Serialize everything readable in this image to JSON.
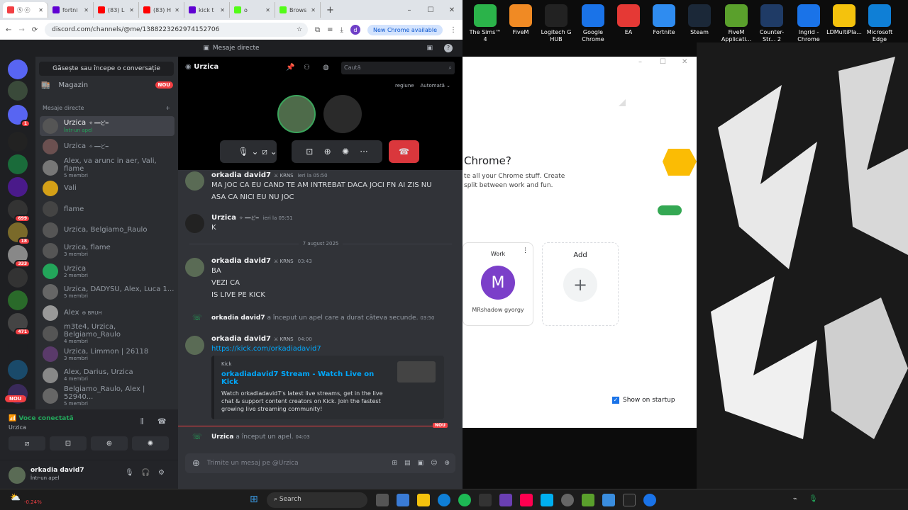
{
  "browser": {
    "tabs": [
      {
        "label": "Ⓢ ⓞ",
        "color": "#f23f43"
      },
      {
        "label": "fortni",
        "color": "#6001d2"
      },
      {
        "label": "(83) L",
        "color": "#ff0000"
      },
      {
        "label": "(83) H",
        "color": "#ff0000"
      },
      {
        "label": "kick t",
        "color": "#6001d2"
      },
      {
        "label": "o",
        "color": "#53fc18"
      },
      {
        "label": "Brows",
        "color": "#53fc18"
      }
    ],
    "url": "discord.com/channels/@me/1388223262974152706",
    "new_chrome": "New Chrome available",
    "profile_letter": "d"
  },
  "discord": {
    "title": "Mesaje directe",
    "find_conversation": "Găsește sau începe o conversație",
    "shop": "Magazin",
    "shop_badge": "NOU",
    "dm_header": "Mesaje directe",
    "dms": [
      {
        "name": "Urzica",
        "tag": "✧ ━━ど━",
        "sub": "Într-un apel",
        "color": "#555",
        "selected": true
      },
      {
        "name": "Urzica",
        "tag": "✧ ━━ど━",
        "sub": "",
        "color": "#6b5050"
      },
      {
        "name": "Alex, va arunc in aer, Vali, flame",
        "sub": "5 membri",
        "color": "#777"
      },
      {
        "name": "Vali",
        "sub": "",
        "color": "#d4a017"
      },
      {
        "name": "flame",
        "sub": "",
        "color": "#444"
      },
      {
        "name": "Urzica, Belgiamo_Raulo",
        "sub": "",
        "color": "#555"
      },
      {
        "name": "Urzica, flame",
        "sub": "3 membri",
        "color": "#555"
      },
      {
        "name": "Urzica",
        "sub": "2 membri",
        "color": "#23a55a"
      },
      {
        "name": "Urzica, DADYSU, Alex, Luca 1...",
        "sub": "5 membri",
        "color": "#666"
      },
      {
        "name": "Alex",
        "tag": "⊕ BRUH",
        "sub": "",
        "color": "#999"
      },
      {
        "name": "m3te4, Urzica, Belgiamo_Raulo",
        "sub": "4 membri",
        "color": "#555"
      },
      {
        "name": "Urzica, Limmon | 26118",
        "sub": "3 membri",
        "color": "#5a3a6a"
      },
      {
        "name": "Alex, Darius, Urzica",
        "sub": "4 membri",
        "color": "#888"
      },
      {
        "name": "Belgiamo_Raulo, Alex | 52940...",
        "sub": "5 membri",
        "color": "#666"
      }
    ],
    "guild_badges": [
      "1",
      "699",
      "18",
      "333",
      "471"
    ],
    "guild_new": "NOU",
    "voice": {
      "status": "Voce conectată",
      "channel": "Urzica"
    },
    "user": {
      "name": "orkadia david7",
      "status": "Într-un apel"
    },
    "chat_header": "Urzica",
    "search_placeholder": "Caută",
    "region_label": "regiune",
    "region_value": "Automată",
    "messages": [
      {
        "author": "orkadia david7",
        "tag": "⚔ KRNS",
        "time": "ieri la 05:50",
        "lines": [
          "MA JOC CA EU CAND TE AM INTREBAT DACA JOCI FN AI ZIS NU",
          "ASA CA NICI EU NU JOC"
        ]
      },
      {
        "author": "Urzica",
        "tag": "✧ ━━ど━",
        "time": "ieri la 05:51",
        "lines": [
          "K"
        ]
      },
      {
        "author": "orkadia david7",
        "tag": "⚔ KRNS",
        "time": "03:43",
        "lines": [
          "BA",
          "VEZI CA",
          "IS LIVE PE KICK"
        ]
      },
      {
        "author": "orkadia david7",
        "tag": "⚔ KRNS",
        "time": "04:00",
        "lines": [
          "https://kick.com/orkadiadavid7"
        ]
      }
    ],
    "date_divider": "7 august 2025",
    "sys_call": {
      "author": "orkadia david7",
      "text": "a început un apel care a durat câteva secunde.",
      "time": "03:50"
    },
    "embed": {
      "provider": "Kick",
      "title": "orkadiadavid7 Stream - Watch Live on Kick",
      "desc": "Watch orkadiadavid7's latest live streams, get in the live chat & support content creators on Kick. Join the fastest growing live streaming community!"
    },
    "new_marker": "NOU",
    "sys_call2": {
      "author": "Urzica",
      "text": "a început un apel.",
      "time": "04:03"
    },
    "composer_placeholder": "Trimite un mesaj pe @Urzica"
  },
  "chrome_profile": {
    "heading": "Chrome?",
    "desc1": "te all your Chrome stuff. Create",
    "desc2": "split between work and fun.",
    "card_label": "Work",
    "card_letter": "M",
    "card_name": "MRshadow gyorgy",
    "add_label": "Add",
    "show_on_startup": "Show on startup",
    "accent": "#7b3fc9"
  },
  "desktop_icons": [
    {
      "label": "The Sims™ 4",
      "color": "#2bb34a"
    },
    {
      "label": "FiveM",
      "color": "#f08a24"
    },
    {
      "label": "Logitech G HUB",
      "color": "#222"
    },
    {
      "label": "Google Chrome",
      "color": "#1a73e8"
    },
    {
      "label": "EA",
      "color": "#e53935"
    },
    {
      "label": "Fortnite",
      "color": "#2f8cf0"
    },
    {
      "label": "Steam",
      "color": "#1b2838"
    },
    {
      "label": "FiveM Applicati...",
      "color": "#5aa02c"
    },
    {
      "label": "Counter-Str... 2",
      "color": "#1f3b66"
    },
    {
      "label": "Ingrid - Chrome",
      "color": "#1a73e8"
    },
    {
      "label": "LDMultiPla...",
      "color": "#f4c20d"
    },
    {
      "label": "Microsoft Edge",
      "color": "#0f7fd6"
    }
  ],
  "taskbar": {
    "search": "Search",
    "stock": "-0.24%"
  }
}
